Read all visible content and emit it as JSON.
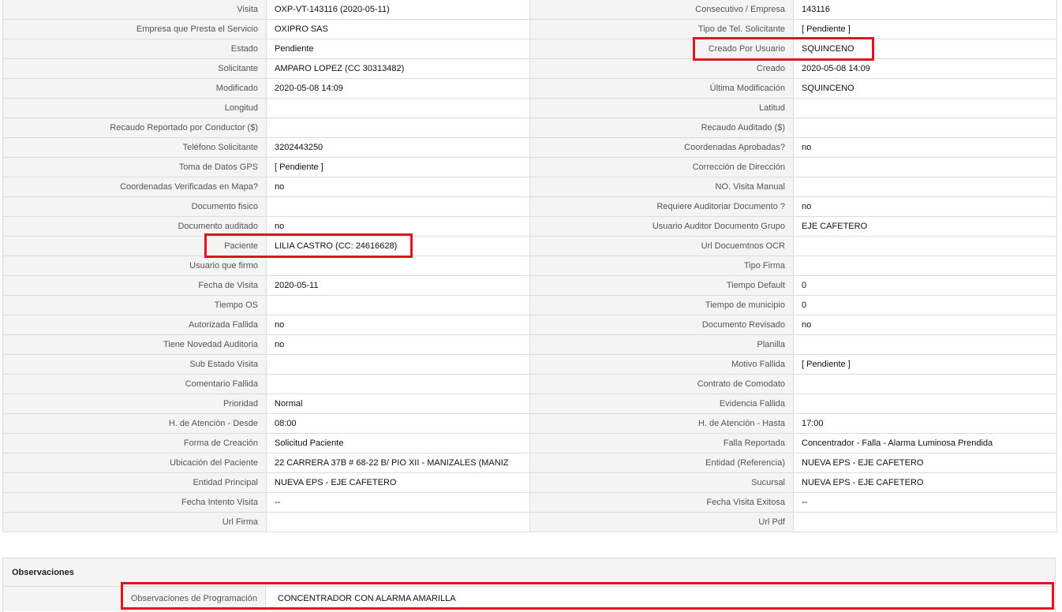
{
  "highlight_color": "#e0141e",
  "rows": [
    {
      "l1": "Visita",
      "v1": "OXP-VT-143116 (2020-05-11)",
      "l2": "Consecutivo / Empresa",
      "v2": "143116"
    },
    {
      "l1": "Empresa que Presta el Servicio",
      "v1": "OXIPRO SAS",
      "l2": "Tipo de Tel. Solicitante",
      "v2": "[ Pendiente ]"
    },
    {
      "l1": "Estado",
      "v1": "Pendiente",
      "l2": "Creado Por Usuario",
      "v2": "SQUINCENO"
    },
    {
      "l1": "Solicitante",
      "v1": "AMPARO LOPEZ (CC 30313482)",
      "l2": "Creado",
      "v2": "2020-05-08 14:09"
    },
    {
      "l1": "Modificado",
      "v1": "2020-05-08 14:09",
      "l2": "Última Modificación",
      "v2": " SQUINCENO"
    },
    {
      "l1": "Longitud",
      "v1": "",
      "l2": "Latitud",
      "v2": ""
    },
    {
      "l1": "Recaudo Reportado por Conductor ($)",
      "v1": "",
      "l2": "Recaudo Auditado ($)",
      "v2": ""
    },
    {
      "l1": "Teléfono Solicitante",
      "v1": "3202443250",
      "l2": "Coordenadas Aprobadas?",
      "v2": " no"
    },
    {
      "l1": "Toma de Datos GPS",
      "v1": "[ Pendiente ]",
      "l2": "Corrección de Dirección",
      "v2": ""
    },
    {
      "l1": "Coordenadas Verificadas en Mapa?",
      "v1": " no",
      "l2": "NO. Visita Manual",
      "v2": ""
    },
    {
      "l1": "Documento fisico",
      "v1": "",
      "l2": "Requiere Auditoriar Documento ?",
      "v2": " no"
    },
    {
      "l1": "Documento auditado",
      "v1": "no",
      "l2": "Usuario Auditor Documento Grupo",
      "v2": "EJE CAFETERO"
    },
    {
      "l1": "Paciente",
      "v1": "LILIA CASTRO (CC: 24616628)",
      "l2": "Url Docuemtnos OCR",
      "v2": ""
    },
    {
      "l1": "Usuario que firmo",
      "v1": "",
      "l2": "Tipo Firma",
      "v2": ""
    },
    {
      "l1": "Fecha de Visita",
      "v1": " 2020-05-11",
      "l2": "Tiempo Default",
      "v2": "0"
    },
    {
      "l1": "Tiempo OS",
      "v1": "",
      "l2": "Tiempo de municipio",
      "v2": "0"
    },
    {
      "l1": "Autorizada Fallida",
      "v1": " no",
      "l2": "Documento Revisado",
      "v2": " no"
    },
    {
      "l1": "Tiene Novedad Auditoria",
      "v1": " no",
      "l2": "Planilla",
      "v2": ""
    },
    {
      "l1": "Sub Estado Visita",
      "v1": "",
      "l2": "Motivo Fallida",
      "v2": "[ Pendiente ]"
    },
    {
      "l1": "Comentario Fallida",
      "v1": "",
      "l2": "Contrato de Comodato",
      "v2": ""
    },
    {
      "l1": "Prioridad",
      "v1": "Normal",
      "l2": "Evidencia Fallida",
      "v2": ""
    },
    {
      "l1": "H. de Atención - Desde",
      "v1": "08:00",
      "l2": "H. de Atención - Hasta",
      "v2": "17:00"
    },
    {
      "l1": "Forma de Creación",
      "v1": "Solicitud Paciente",
      "l2": "Falla Reportada",
      "v2": "Concentrador - Falla - Alarma Luminosa Prendida"
    },
    {
      "l1": "Ubicación del Paciente",
      "v1": "22 CARRERA 37B # 68-22 B/ PIO XII - MANIZALES (MANIZ",
      "l2": "Entidad (Referencia)",
      "v2": "NUEVA EPS - EJE CAFETERO"
    },
    {
      "l1": "Entidad Principal",
      "v1": "NUEVA EPS - EJE CAFETERO",
      "l2": "Sucursal",
      "v2": "NUEVA EPS - EJE CAFETERO"
    },
    {
      "l1": "Fecha Intento Visita",
      "v1": " --",
      "l2": "Fecha Visita Exitosa",
      "v2": " --"
    },
    {
      "l1": "Url Firma",
      "v1": "",
      "l2": "Url Pdf",
      "v2": ""
    }
  ],
  "observaciones": {
    "title": "Observaciones",
    "label": "Observaciones de Programación",
    "value": "CONCENTRADOR CON ALARMA AMARILLA"
  }
}
